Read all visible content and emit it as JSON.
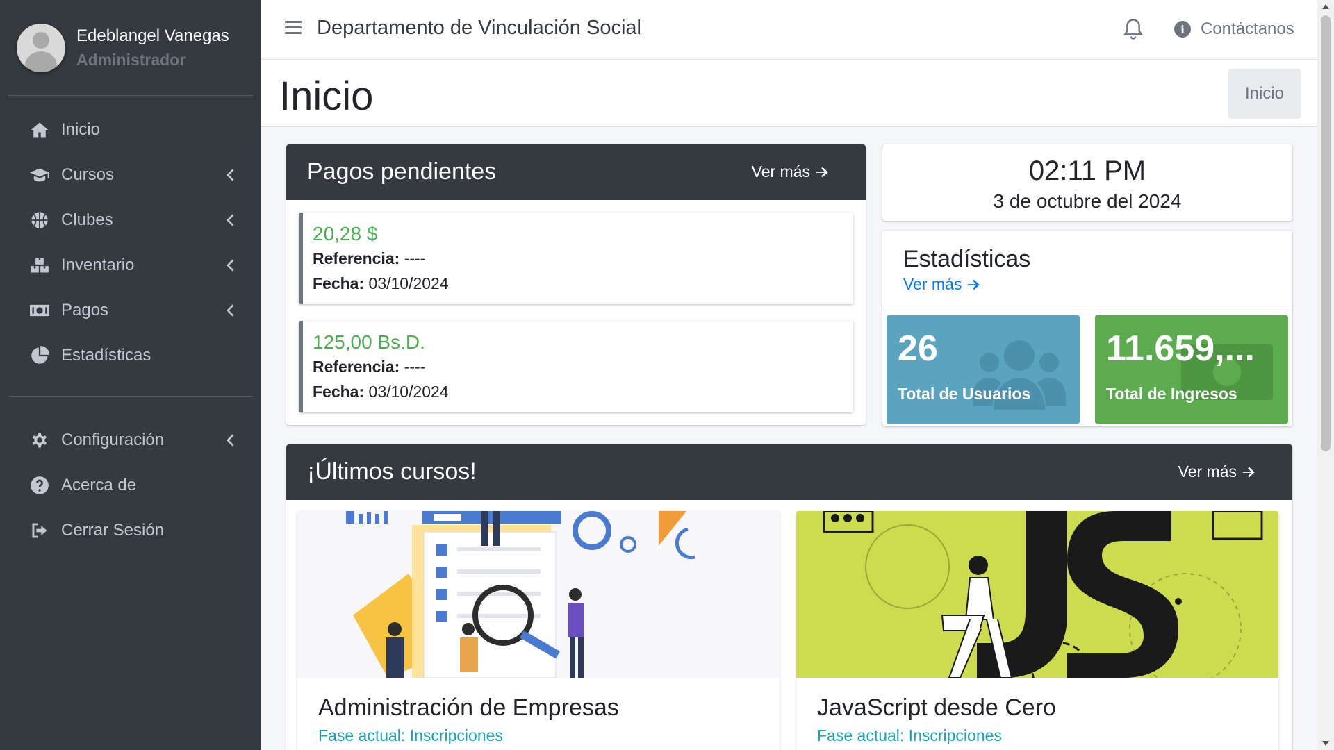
{
  "user": {
    "name": "Edeblangel Vanegas",
    "role": "Administrador"
  },
  "sidebar": {
    "items": [
      {
        "label": "Inicio",
        "icon": "home-icon",
        "submenu": false
      },
      {
        "label": "Cursos",
        "icon": "graduation-cap-icon",
        "submenu": true
      },
      {
        "label": "Clubes",
        "icon": "basketball-icon",
        "submenu": true
      },
      {
        "label": "Inventario",
        "icon": "boxes-icon",
        "submenu": true
      },
      {
        "label": "Pagos",
        "icon": "money-bill-icon",
        "submenu": true
      },
      {
        "label": "Estadísticas",
        "icon": "chart-pie-icon",
        "submenu": false
      }
    ],
    "bottom_items": [
      {
        "label": "Configuración",
        "icon": "gear-icon",
        "submenu": true
      },
      {
        "label": "Acerca de",
        "icon": "question-circle-icon",
        "submenu": false
      },
      {
        "label": "Cerrar Sesión",
        "icon": "sign-out-icon",
        "submenu": false
      }
    ]
  },
  "topbar": {
    "title": "Departamento de Vinculación Social",
    "contact_label": "Contáctanos"
  },
  "header": {
    "title": "Inicio",
    "breadcrumb": "Inicio"
  },
  "pagos": {
    "title": "Pagos pendientes",
    "more_label": "Ver más",
    "reference_label": "Referencia:",
    "date_label": "Fecha:",
    "items": [
      {
        "amount": "20,28 $",
        "reference": "----",
        "date": "03/10/2024"
      },
      {
        "amount": "125,00 Bs.D.",
        "reference": "----",
        "date": "03/10/2024"
      }
    ]
  },
  "clock": {
    "time": "02:11 PM",
    "date": "3 de octubre del 2024"
  },
  "stats": {
    "title": "Estadísticas",
    "more_label": "Ver más",
    "users": {
      "value": "26",
      "label": "Total de Usuarios",
      "color": "#17a2b8"
    },
    "income": {
      "value": "11.659,...",
      "label": "Total de Ingresos",
      "color": "#28a745"
    }
  },
  "courses": {
    "title": "¡Últimos cursos!",
    "more_label": "Ver más",
    "items": [
      {
        "title": "Administración de Empresas",
        "phase": "Fase actual: Inscripciones"
      },
      {
        "title": "JavaScript desde Cero",
        "phase": "Fase actual: Inscripciones"
      }
    ]
  },
  "colors": {
    "sidebar_bg": "#343a40",
    "success": "#4caf50",
    "link": "#007bff",
    "info": "#17a2b8",
    "js_bg": "#cddc4f"
  }
}
